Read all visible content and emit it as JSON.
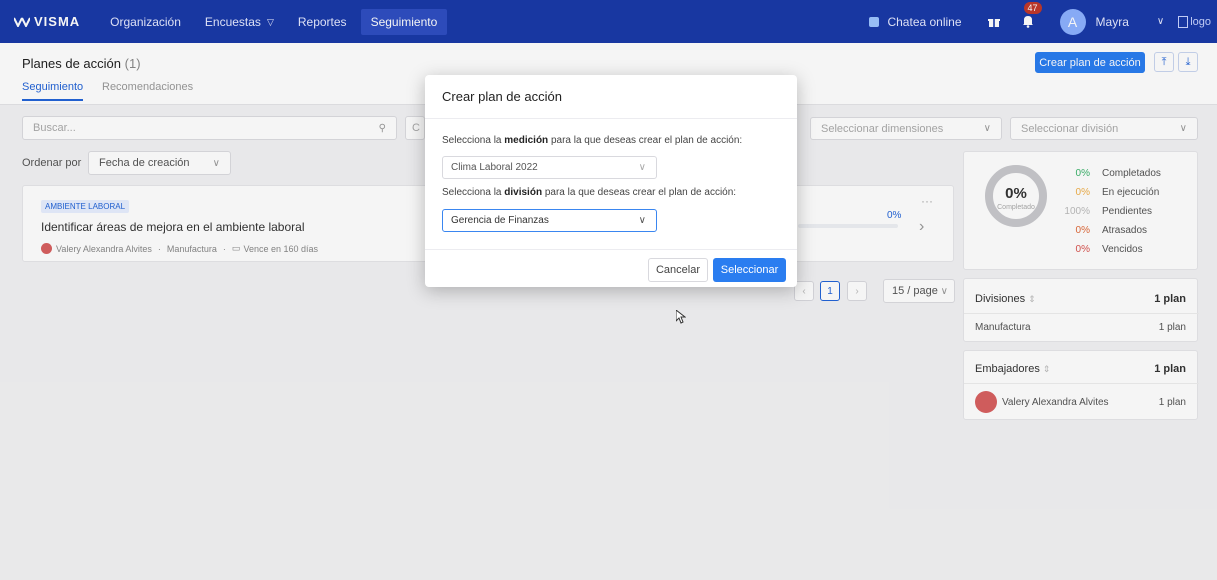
{
  "nav": {
    "brand": "VISMA",
    "links": [
      {
        "label": "Organización"
      },
      {
        "label": "Encuestas"
      },
      {
        "label": "Reportes"
      },
      {
        "label": "Seguimiento"
      }
    ],
    "chat_label": "Chatea online",
    "notification_count": "47",
    "avatar_initial": "A",
    "user_name": "Mayra",
    "logo_alt": "logo"
  },
  "header": {
    "title": "Planes de acción",
    "count": "(1)",
    "tabs": [
      {
        "label": "Seguimiento"
      },
      {
        "label": "Recomendaciones"
      }
    ],
    "create_button": "Crear plan de acción"
  },
  "filters": {
    "search_placeholder": "Buscar...",
    "dimensions_placeholder": "Seleccionar dimensiones",
    "division_placeholder": "Seleccionar división",
    "sort_label": "Ordenar por",
    "sort_value": "Fecha de creación"
  },
  "plan_card": {
    "tag": "AMBIENTE LABORAL",
    "title": "Identificar áreas de mejora en el ambiente laboral",
    "owner": "Valery Alexandra Alvites",
    "division": "Manufactura",
    "due": "Vence en 160 días",
    "progress": "0%",
    "progress_value": 0
  },
  "pagination": {
    "current_page": "1",
    "page_size": "15 / page"
  },
  "summary": {
    "center_value": "0%",
    "center_label": "Completado",
    "rows": [
      {
        "pct": "0%",
        "label": "Completados",
        "color": "#3bb36b"
      },
      {
        "pct": "0%",
        "label": "En ejecución",
        "color": "#f0b04a"
      },
      {
        "pct": "100%",
        "label": "Pendientes",
        "color": "#bbbbbb"
      },
      {
        "pct": "0%",
        "label": "Atrasados",
        "color": "#e06a3a"
      },
      {
        "pct": "0%",
        "label": "Vencidos",
        "color": "#d9534f"
      }
    ]
  },
  "divisions": {
    "title": "Divisiones",
    "total": "1 plan",
    "rows": [
      {
        "name": "Manufactura",
        "value": "1 plan"
      }
    ]
  },
  "ambassadors": {
    "title": "Embajadores",
    "total": "1 plan",
    "rows": [
      {
        "name": "Valery Alexandra Alvites",
        "value": "1 plan"
      }
    ]
  },
  "modal": {
    "title": "Crear plan de acción",
    "measure_prompt_prefix": "Selecciona la",
    "measure_prompt_bold": "medición",
    "measure_prompt_suffix": "para la que deseas crear el plan de acción:",
    "measure_value": "Clima Laboral 2022",
    "division_prompt_prefix": "Selecciona la",
    "division_prompt_bold": "división",
    "division_prompt_suffix": "para la que deseas crear el plan de acción:",
    "division_value": "Gerencia de Finanzas",
    "cancel_label": "Cancelar",
    "select_label": "Seleccionar"
  }
}
